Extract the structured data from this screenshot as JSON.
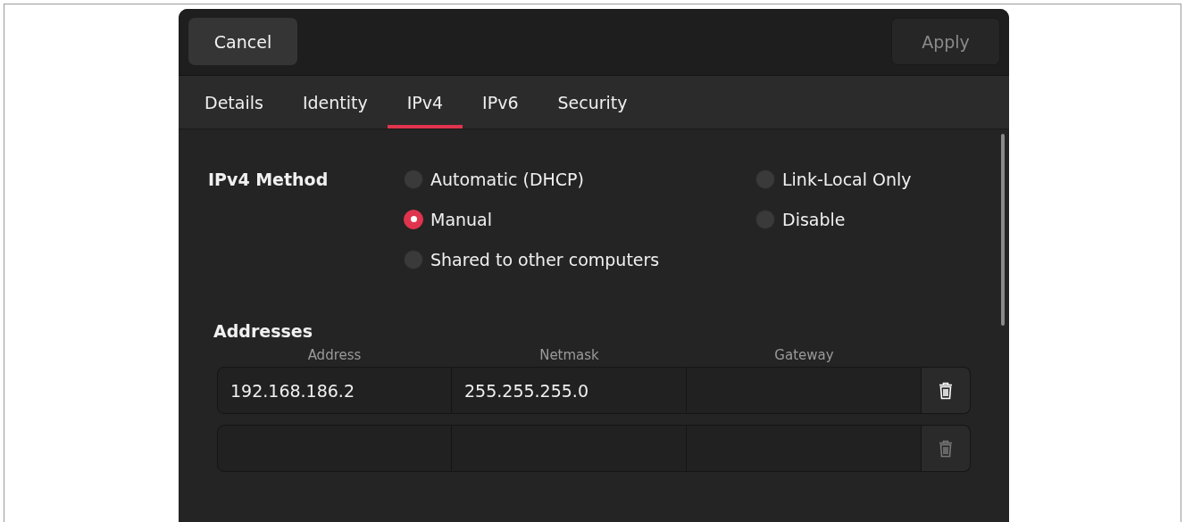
{
  "header": {
    "cancel": {
      "label": "Cancel",
      "disabled": false
    },
    "apply": {
      "label": "Apply",
      "disabled": true
    }
  },
  "tabs": [
    {
      "label": "Details",
      "selected": false
    },
    {
      "label": "Identity",
      "selected": false
    },
    {
      "label": "IPv4",
      "selected": true
    },
    {
      "label": "IPv6",
      "selected": false
    },
    {
      "label": "Security",
      "selected": false
    }
  ],
  "ipv4_method": {
    "label": "IPv4 Method",
    "options": [
      {
        "label": "Automatic (DHCP)",
        "selected": false
      },
      {
        "label": "Link-Local Only",
        "selected": false
      },
      {
        "label": "Manual",
        "selected": true
      },
      {
        "label": "Disable",
        "selected": false
      },
      {
        "label": "Shared to other computers",
        "selected": false
      }
    ]
  },
  "addresses": {
    "title": "Addresses",
    "columns": [
      "Address",
      "Netmask",
      "Gateway"
    ],
    "rows": [
      {
        "address": "192.168.186.2",
        "netmask": "255.255.255.0",
        "delete_disabled": false
      },
      {
        "delete_disabled": true
      }
    ]
  }
}
